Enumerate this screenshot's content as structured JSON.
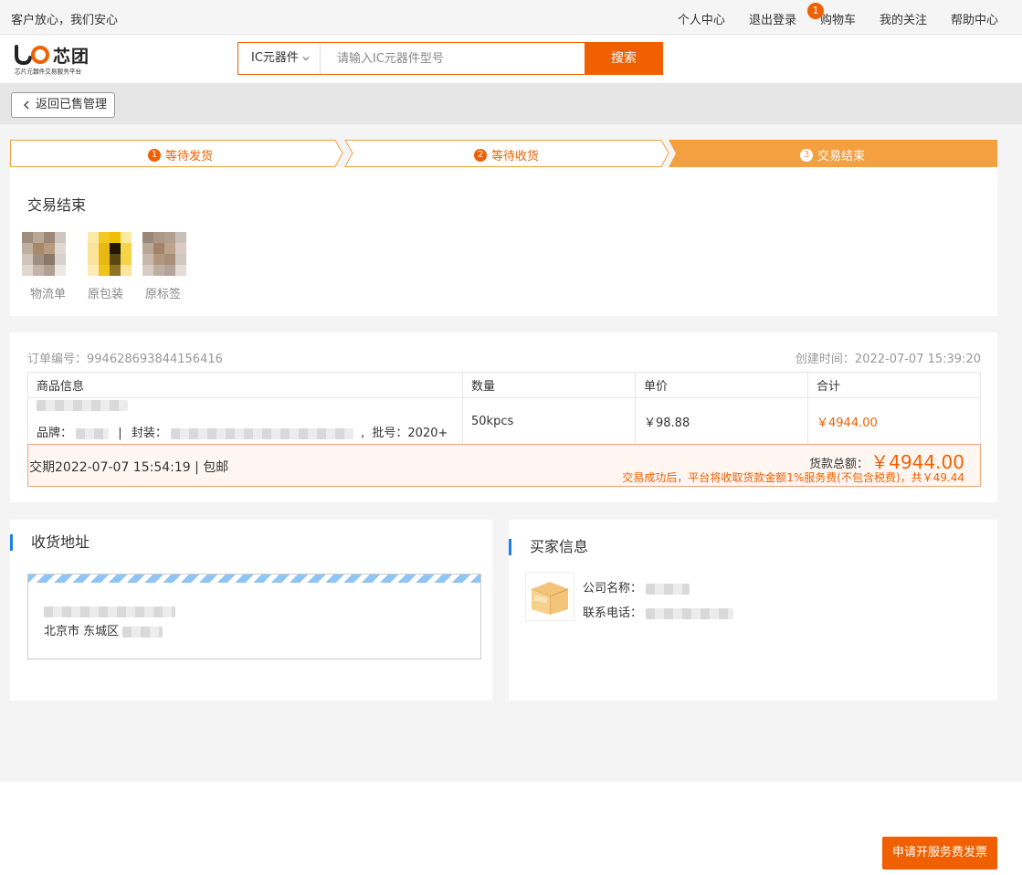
{
  "topbar": {
    "slogan": "客户放心，我们安心",
    "nav": [
      "个人中心",
      "退出登录",
      "购物车",
      "我的关注",
      "帮助中心"
    ],
    "cart_count": "1"
  },
  "header": {
    "logo_text": "芯团",
    "logo_subtitle": "芯片元器件交易服务平台",
    "search_category": "IC元器件",
    "search_placeholder": "请输入IC元器件型号",
    "search_button": "搜索"
  },
  "back_button": "返回已售管理",
  "steps": [
    {
      "num": "1",
      "label": "等待发货"
    },
    {
      "num": "2",
      "label": "等待收货"
    },
    {
      "num": "3",
      "label": "交易结束"
    }
  ],
  "status": {
    "title": "交易结束",
    "images": [
      "物流单",
      "原包装",
      "原标签"
    ]
  },
  "order": {
    "order_no": "订单编号：994628693844156416",
    "created": "创建时间：2022-07-07 15:39:20",
    "headers": [
      "商品信息",
      "数量",
      "单价",
      "合计"
    ],
    "brand_label": "品牌：",
    "package_label": "封装：",
    "batch_label": "批号：2020+",
    "quantity": "50kpcs",
    "unit_price": "￥98.88",
    "total": "￥4944.00",
    "delivery": "交期2022-07-07 15:54:19 | 包邮",
    "total_label": "货款总额：",
    "total_amount": "￥4944.00",
    "fee_note": "交易成功后，平台将收取货款金额1%服务费(不包含税费)，共￥49.44"
  },
  "address": {
    "title": "收货地址",
    "region": "北京市 东城区"
  },
  "buyer": {
    "title": "买家信息",
    "company_label": "公司名称：",
    "phone_label": "联系电话："
  },
  "invoice_button": "申请开服务费发票",
  "colors": {
    "brand": "#f06000",
    "step_active": "#f4a040",
    "accent_blue": "#1e7fe6"
  }
}
